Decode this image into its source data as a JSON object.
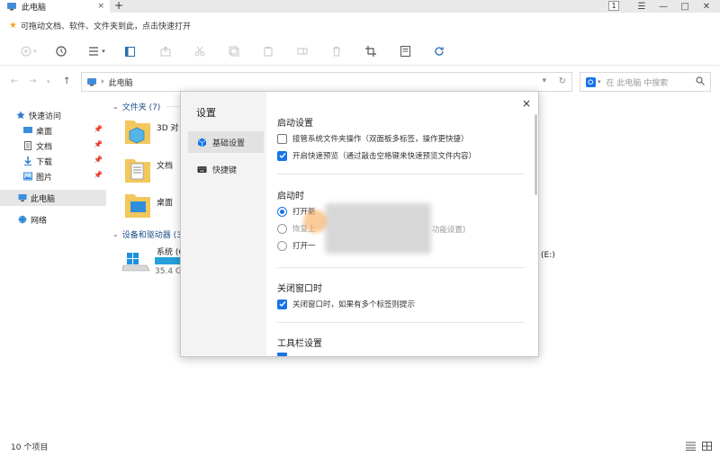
{
  "tab": {
    "title": "此电脑",
    "close": "×",
    "new": "+"
  },
  "window": {
    "count_badge": "1",
    "menu": "☰",
    "minimize": "—",
    "maximize": "□",
    "close": "✕"
  },
  "hint": {
    "text": "可拖动文档、软件、文件夹到此，点击快速打开"
  },
  "address": {
    "crumb": "此电脑",
    "sep": "›"
  },
  "search": {
    "placeholder": "在 此电脑 中搜索"
  },
  "sidebar": {
    "quick_access": "快速访问",
    "items": [
      {
        "label": "桌面"
      },
      {
        "label": "文档"
      },
      {
        "label": "下载"
      },
      {
        "label": "图片"
      }
    ],
    "this_pc": "此电脑",
    "network": "网络"
  },
  "main": {
    "folders_group": "文件夹 (7)",
    "folders": [
      "3D 对",
      "文档",
      "桌面"
    ],
    "drives_group": "设备和驱动器 (3",
    "drive_name": "系统 (C",
    "drive_cap": "35.4 G",
    "drive_e": "(E:)"
  },
  "status": {
    "items": "10 个项目"
  },
  "dialog": {
    "title": "设置",
    "close": "×",
    "nav": [
      {
        "label": "基础设置"
      },
      {
        "label": "快捷键"
      }
    ],
    "startup_settings": {
      "title": "启动设置",
      "options": [
        {
          "label": "接管系统文件夹操作（双面板多标签，操作更快捷）",
          "checked": false
        },
        {
          "label": "开启快速预览（通过敲击空格键来快速预览文件内容）",
          "checked": true
        }
      ]
    },
    "on_start": {
      "title": "启动时",
      "options": [
        {
          "label": "打开新",
          "checked": true
        },
        {
          "label": "恢复上",
          "suffix": "功能设置)",
          "checked": false
        },
        {
          "label": "打开一",
          "checked": false
        }
      ]
    },
    "on_close": {
      "title": "关闭窗口时",
      "options": [
        {
          "label": "关闭窗口时，如果有多个标签则提示",
          "checked": true
        }
      ]
    },
    "toolbar_settings": {
      "title": "工具栏设置"
    }
  },
  "colors": {
    "accent": "#1a73e8",
    "folder": "#f2c75c",
    "drive_bar": "#26a0da"
  }
}
